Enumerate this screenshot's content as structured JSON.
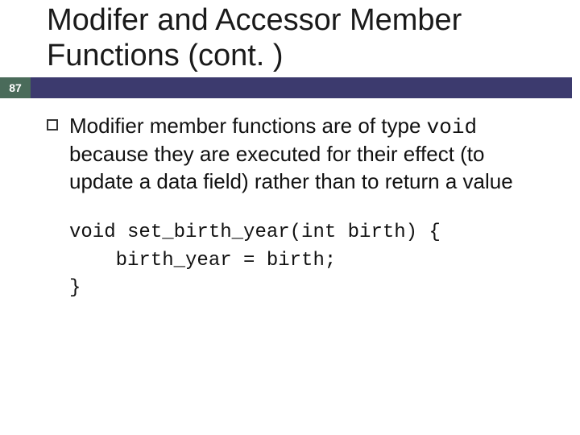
{
  "slide": {
    "title": "Modifer and Accessor Member Functions (cont. )",
    "page_number": "87"
  },
  "bullet": {
    "text_before_code": "Modifier member functions are of type ",
    "inline_code": "void",
    "text_after_code": " because they are executed for their effect (to update a data field) rather than to return a value"
  },
  "code": {
    "line1": "void set_birth_year(int birth) {",
    "line2": "    birth_year = birth;",
    "line3": "}"
  }
}
